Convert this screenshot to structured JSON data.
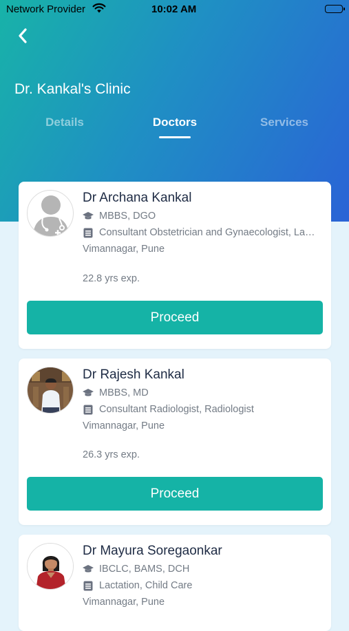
{
  "status_bar": {
    "carrier": "Network Provider",
    "time": "10:02 AM"
  },
  "header": {
    "title": "Dr. Kankal's Clinic",
    "tabs": [
      {
        "label": "Details",
        "active": false
      },
      {
        "label": "Doctors",
        "active": true
      },
      {
        "label": "Services",
        "active": false
      }
    ]
  },
  "doctors": [
    {
      "name": "Dr Archana Kankal",
      "qualification": "MBBS, DGO",
      "specialization": "Consultant Obstetrician and Gynaecologist, Laparoscopic Surgeon",
      "location": "Vimannagar, Pune",
      "experience": "22.8 yrs exp.",
      "button": "Proceed"
    },
    {
      "name": "Dr Rajesh Kankal",
      "qualification": "MBBS, MD",
      "specialization": "Consultant Radiologist, Radiologist",
      "location": "Vimannagar, Pune",
      "experience": "26.3 yrs exp.",
      "button": "Proceed"
    },
    {
      "name": "Dr Mayura Soregaonkar",
      "qualification": "IBCLC, BAMS, DCH",
      "specialization": "Lactation, Child Care",
      "location": "Vimannagar, Pune"
    }
  ],
  "colors": {
    "accent": "#15b3a6",
    "header_gradient_start": "#18b3a8",
    "header_gradient_end": "#2a63d6",
    "page_background": "#e4f3fb"
  }
}
